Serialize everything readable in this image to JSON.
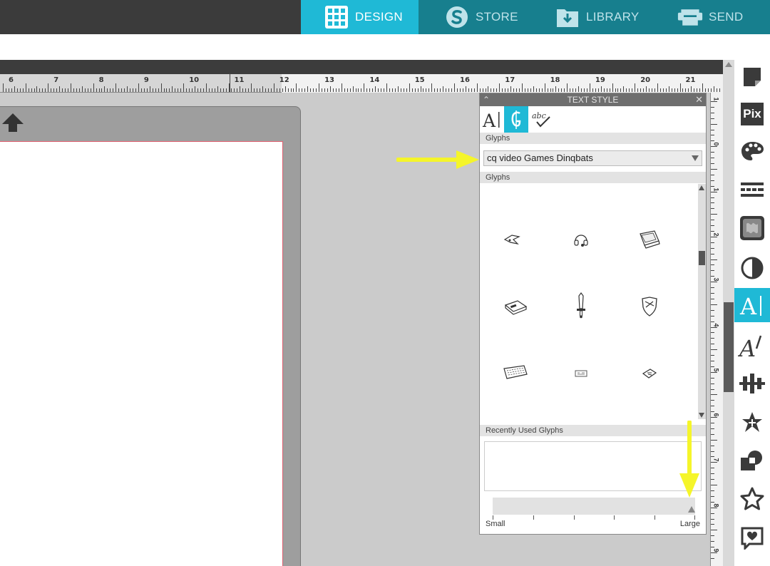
{
  "nav": {
    "tabs": [
      {
        "label": "DESIGN",
        "icon": "grid-icon",
        "active": true
      },
      {
        "label": "STORE",
        "icon": "silhouette-s-icon",
        "active": false
      },
      {
        "label": "LIBRARY",
        "icon": "download-folder-icon",
        "active": false
      },
      {
        "label": "SEND",
        "icon": "cutter-icon",
        "active": false
      }
    ]
  },
  "ruler": {
    "top_numbers": [
      "6",
      "7",
      "8",
      "9",
      "10",
      "11",
      "12",
      "13",
      "14",
      "15",
      "16",
      "17",
      "18",
      "19",
      "20",
      "21"
    ],
    "side_numbers": [
      "1",
      "0",
      "1",
      "2",
      "3",
      "4",
      "5",
      "6",
      "7",
      "8",
      "9"
    ]
  },
  "toolbar": {
    "tools": [
      "page-setup-icon",
      "pixscan-icon",
      "fill-palette-icon",
      "line-style-icon",
      "fill-pattern-icon",
      "transparency-icon",
      "text-style-icon",
      "sketch-font-icon",
      "align-icon",
      "replicate-icon",
      "modify-icon",
      "star-shape-icon",
      "library-heart-icon"
    ],
    "active_index": 6,
    "pixscan_label": "Pix"
  },
  "panel": {
    "title": "TEXT STYLE",
    "tabs": [
      {
        "icon": "text-font-icon",
        "label": "A|",
        "active": false
      },
      {
        "icon": "glyph-icon",
        "active": true
      },
      {
        "icon": "spellcheck-icon",
        "label": "abc",
        "active": false
      }
    ],
    "glyphs_label": "Glyphs",
    "font_selected": "cq video Games Dinqbats",
    "glyphs_grid_label": "Glyphs",
    "glyph_items": [
      "fighter-jet-glyph",
      "headset-glyph",
      "handheld-console-glyph",
      "console-glyph",
      "sword-glyph",
      "shield-glyph",
      "keyboard-glyph",
      "cartridge-glyph",
      "dice-glyph"
    ],
    "recent_label": "Recently Used Glyphs",
    "size_small": "Small",
    "size_large": "Large",
    "size_value": 1.0
  },
  "annotations": {
    "color": "#f5f52a"
  },
  "colors": {
    "accent": "#1fb9d6",
    "nav_inactive": "#177f8e",
    "topbar": "#3b3b3b"
  }
}
